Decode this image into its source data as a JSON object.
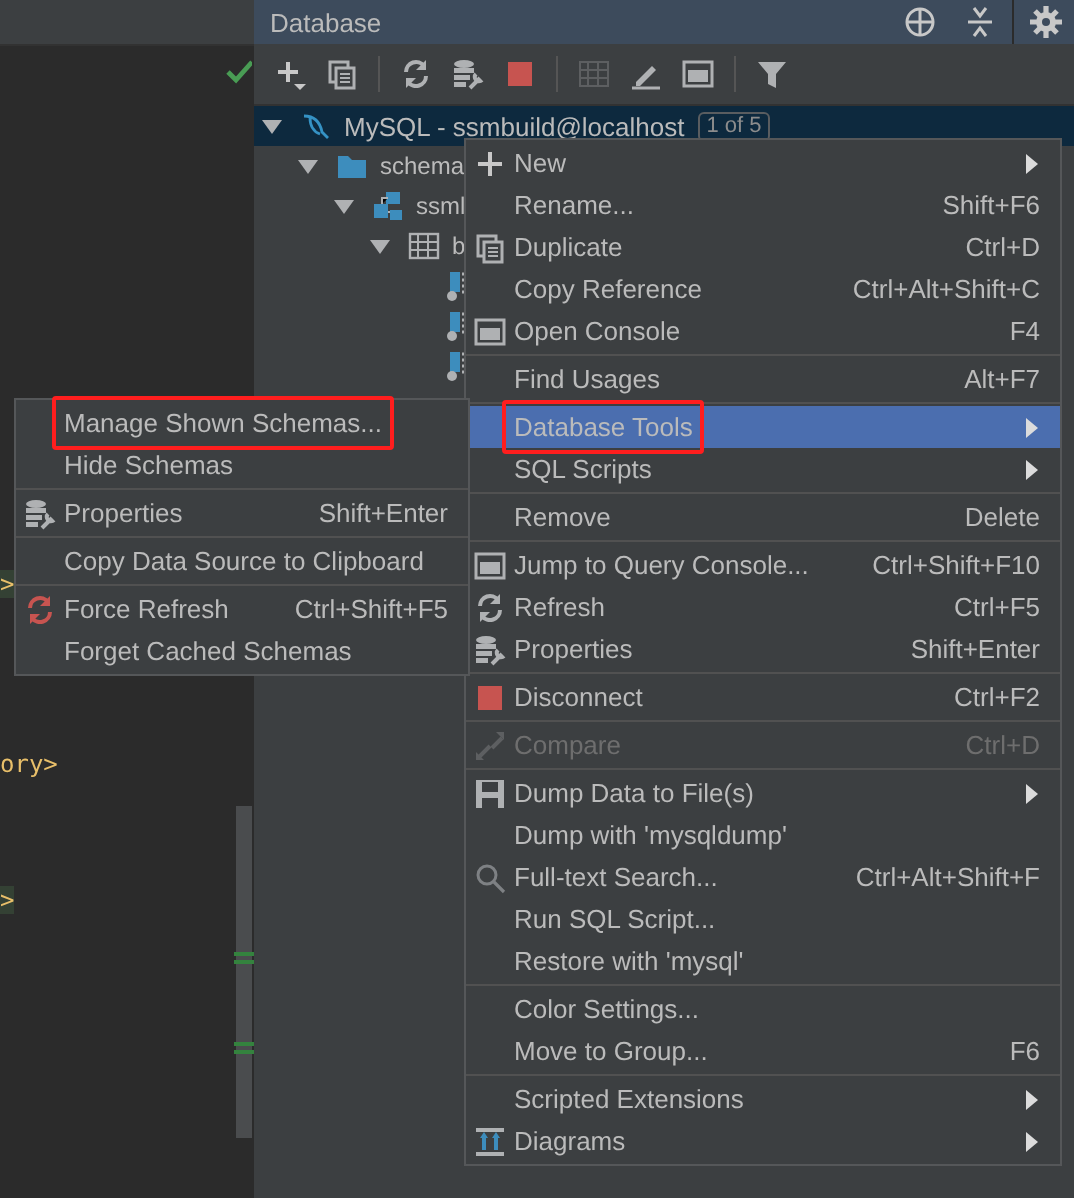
{
  "editor": {
    "status_ok": true,
    "fragments": [
      {
        "text": ">",
        "highlighted": true
      },
      {
        "text": "ory>",
        "highlighted": false
      },
      {
        "text": ">",
        "highlighted": true
      }
    ]
  },
  "database_panel": {
    "title": "Database",
    "tree": [
      {
        "label": "MySQL - ssmbuild@localhost",
        "badge": "1 of 5",
        "kind": "datasource",
        "expanded": true,
        "selected": true,
        "children": [
          {
            "label": "schema",
            "kind": "folder",
            "expanded": true,
            "selected": false,
            "children": [
              {
                "label": "ssml",
                "kind": "schema",
                "expanded": true,
                "selected": false,
                "children": [
                  {
                    "label": "b",
                    "kind": "table",
                    "expanded": true,
                    "selected": false,
                    "children": [
                      {
                        "kind": "column",
                        "selected": false
                      },
                      {
                        "kind": "column",
                        "selected": false
                      },
                      {
                        "kind": "column",
                        "selected": false
                      }
                    ]
                  }
                ]
              }
            ]
          }
        ]
      }
    ]
  },
  "context_menu": {
    "groups": [
      [
        {
          "label": "New",
          "submenu": true,
          "selected": false,
          "disabled": false,
          "annotated": false
        },
        {
          "label": "Rename...",
          "shortcut": "Shift+F6",
          "submenu": false,
          "selected": false,
          "disabled": false,
          "annotated": false
        },
        {
          "label": "Duplicate",
          "shortcut": "Ctrl+D",
          "submenu": false,
          "selected": false,
          "disabled": false,
          "annotated": false
        },
        {
          "label": "Copy Reference",
          "shortcut": "Ctrl+Alt+Shift+C",
          "submenu": false,
          "selected": false,
          "disabled": false,
          "annotated": false
        },
        {
          "label": "Open Console",
          "shortcut": "F4",
          "submenu": false,
          "selected": false,
          "disabled": false,
          "annotated": false
        }
      ],
      [
        {
          "label": "Find Usages",
          "shortcut": "Alt+F7",
          "submenu": false,
          "selected": false,
          "disabled": false,
          "annotated": false
        }
      ],
      [
        {
          "label": "Database Tools",
          "submenu": true,
          "selected": true,
          "disabled": false,
          "annotated": true
        },
        {
          "label": "SQL Scripts",
          "submenu": true,
          "selected": false,
          "disabled": false,
          "annotated": false
        }
      ],
      [
        {
          "label": "Remove",
          "shortcut": "Delete",
          "submenu": false,
          "selected": false,
          "disabled": false,
          "annotated": false
        }
      ],
      [
        {
          "label": "Jump to Query Console...",
          "shortcut": "Ctrl+Shift+F10",
          "submenu": false,
          "selected": false,
          "disabled": false,
          "annotated": false
        },
        {
          "label": "Refresh",
          "shortcut": "Ctrl+F5",
          "submenu": false,
          "selected": false,
          "disabled": false,
          "annotated": false
        },
        {
          "label": "Properties",
          "shortcut": "Shift+Enter",
          "submenu": false,
          "selected": false,
          "disabled": false,
          "annotated": false
        }
      ],
      [
        {
          "label": "Disconnect",
          "shortcut": "Ctrl+F2",
          "submenu": false,
          "selected": false,
          "disabled": false,
          "annotated": false
        }
      ],
      [
        {
          "label": "Compare",
          "shortcut": "Ctrl+D",
          "submenu": false,
          "selected": false,
          "disabled": true,
          "annotated": false
        }
      ],
      [
        {
          "label": "Dump Data to File(s)",
          "submenu": true,
          "selected": false,
          "disabled": false,
          "annotated": false
        },
        {
          "label": "Dump with 'mysqldump'",
          "submenu": false,
          "selected": false,
          "disabled": false,
          "annotated": false
        },
        {
          "label": "Full-text Search...",
          "shortcut": "Ctrl+Alt+Shift+F",
          "submenu": false,
          "selected": false,
          "disabled": false,
          "annotated": false
        },
        {
          "label": "Run SQL Script...",
          "submenu": false,
          "selected": false,
          "disabled": false,
          "annotated": false
        },
        {
          "label": "Restore with 'mysql'",
          "submenu": false,
          "selected": false,
          "disabled": false,
          "annotated": false
        }
      ],
      [
        {
          "label": "Color Settings...",
          "submenu": false,
          "selected": false,
          "disabled": false,
          "annotated": false
        },
        {
          "label": "Move to Group...",
          "shortcut": "F6",
          "submenu": false,
          "selected": false,
          "disabled": false,
          "annotated": false
        }
      ],
      [
        {
          "label": "Scripted Extensions",
          "submenu": true,
          "selected": false,
          "disabled": false,
          "annotated": false
        },
        {
          "label": "Diagrams",
          "submenu": true,
          "selected": false,
          "disabled": false,
          "annotated": false
        }
      ]
    ]
  },
  "submenu": {
    "groups": [
      [
        {
          "label": "Manage Shown Schemas...",
          "submenu": false,
          "selected": false,
          "disabled": false,
          "annotated": true
        },
        {
          "label": "Hide Schemas",
          "submenu": false,
          "selected": false,
          "disabled": false,
          "annotated": false
        }
      ],
      [
        {
          "label": "Properties",
          "shortcut": "Shift+Enter",
          "submenu": false,
          "selected": false,
          "disabled": false,
          "annotated": false
        }
      ],
      [
        {
          "label": "Copy Data Source to Clipboard",
          "submenu": false,
          "selected": false,
          "disabled": false,
          "annotated": false
        }
      ],
      [
        {
          "label": "Force Refresh",
          "shortcut": "Ctrl+Shift+F5",
          "submenu": false,
          "selected": false,
          "disabled": false,
          "annotated": false
        },
        {
          "label": "Forget Cached Schemas",
          "submenu": false,
          "selected": false,
          "disabled": false,
          "annotated": false
        }
      ]
    ]
  }
}
